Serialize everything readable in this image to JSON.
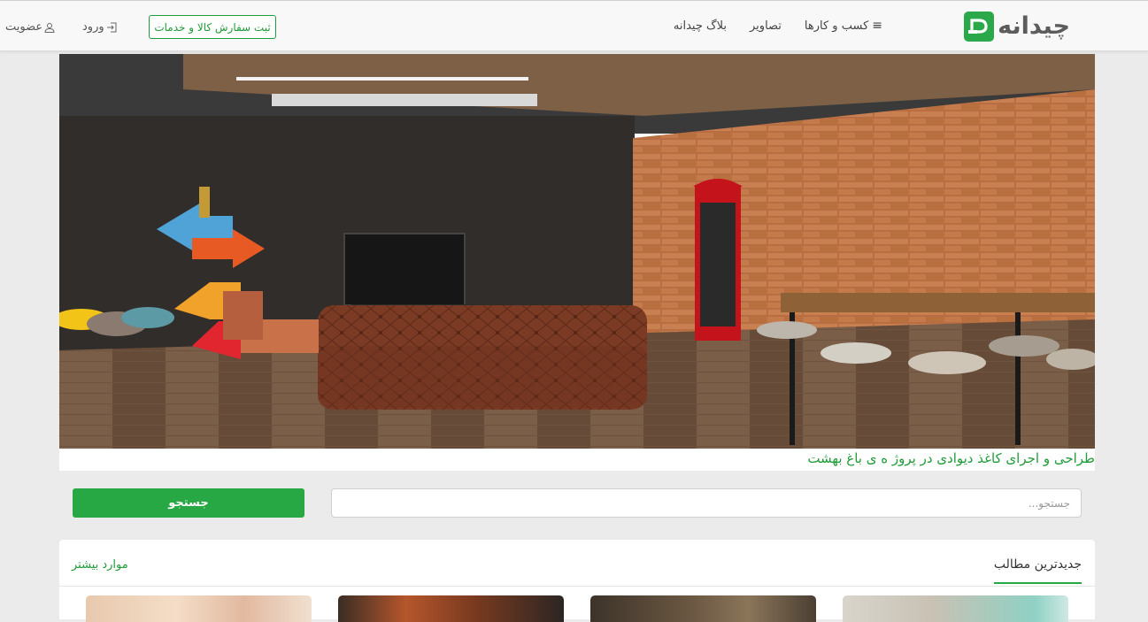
{
  "brand": {
    "name": "چیدانه",
    "color": "#2aa84a"
  },
  "nav": {
    "items": [
      {
        "label": "کسب و کارها",
        "icon": "hamburger-icon"
      },
      {
        "label": "تصاویر"
      },
      {
        "label": "بلاگ چیدانه"
      }
    ],
    "order_button": "ثبت سفارش کالا و خدمات",
    "login": "ورود",
    "register": "عضویت"
  },
  "hero": {
    "caption": "طراحی و اجرای کاغذ دیوادی در پروژ ه ی باغ بهشت"
  },
  "search": {
    "placeholder": "جستجو...",
    "button": "جستجو"
  },
  "latest": {
    "title": "جدیدترین مطالب",
    "more": "موارد بیشتر"
  },
  "colors": {
    "accent": "#28a745",
    "link": "#1f9b39"
  }
}
